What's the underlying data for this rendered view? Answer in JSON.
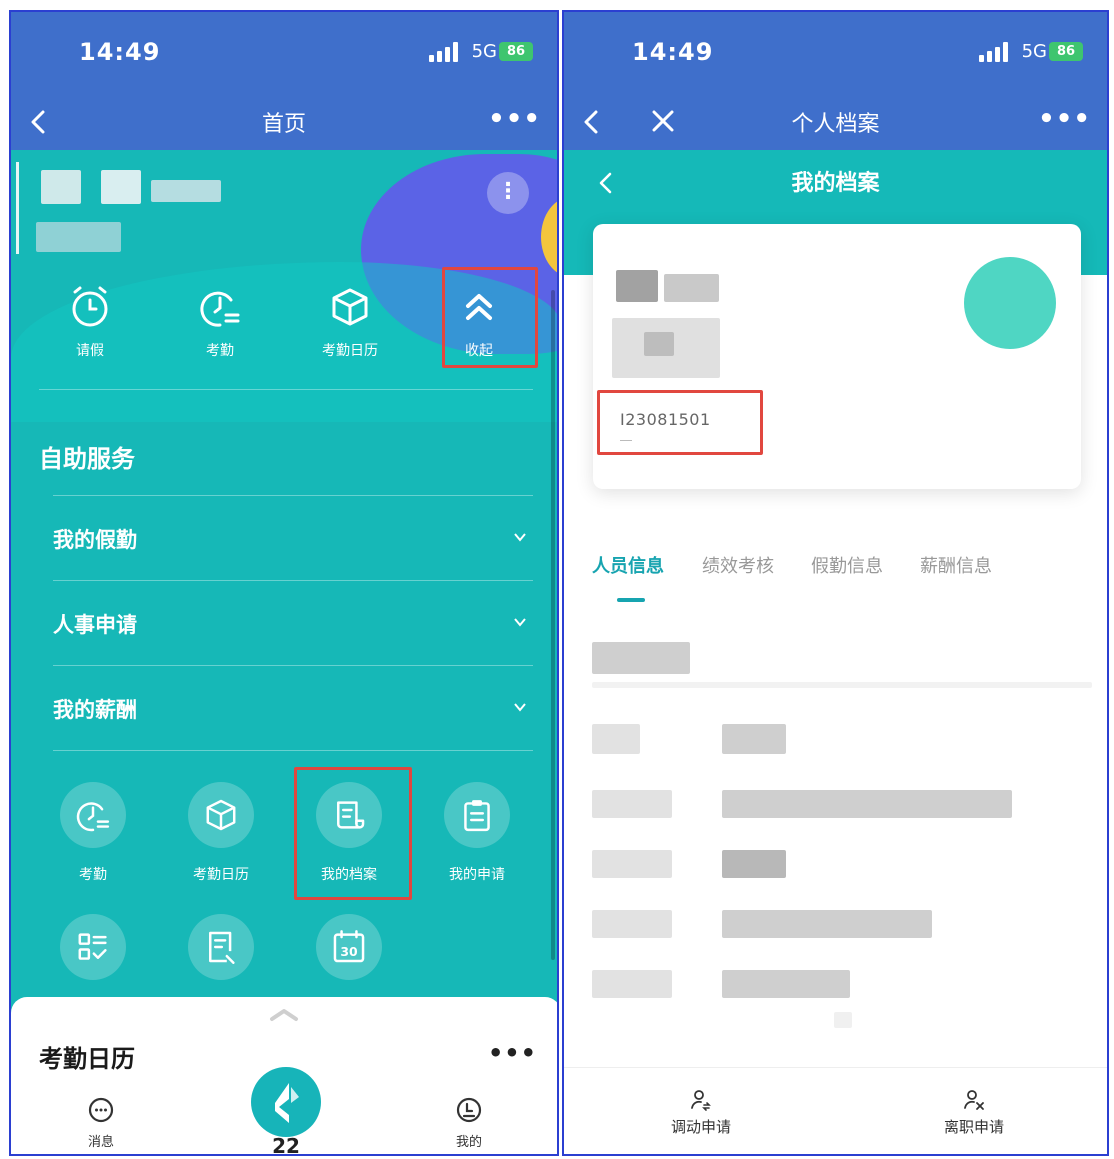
{
  "status_bar": {
    "time": "14:49",
    "network": "5G",
    "battery": "86"
  },
  "left_screen": {
    "nav": {
      "title": "首页",
      "more": "•••"
    },
    "quick_actions": [
      {
        "label": "请假",
        "icon": "alarm-clock-icon"
      },
      {
        "label": "考勤",
        "icon": "attendance-clock-icon"
      },
      {
        "label": "考勤日历",
        "icon": "cube-icon"
      },
      {
        "label": "收起",
        "icon": "double-chevron-up-icon"
      }
    ],
    "section_title": "自助服务",
    "accordion": [
      {
        "label": "我的假勤"
      },
      {
        "label": "人事申请"
      },
      {
        "label": "我的薪酬"
      }
    ],
    "grid": [
      {
        "label": "考勤",
        "icon": "attendance-clock-icon"
      },
      {
        "label": "考勤日历",
        "icon": "cube-icon"
      },
      {
        "label": "我的档案",
        "icon": "scroll-icon"
      },
      {
        "label": "我的申请",
        "icon": "clipboard-icon"
      },
      {
        "label": "",
        "icon": "checklist-icon"
      },
      {
        "label": "",
        "icon": "edit-doc-icon"
      },
      {
        "label": "",
        "icon": "calendar-30-icon"
      }
    ],
    "bottom_sheet": {
      "title": "考勤日历",
      "more": "•••"
    },
    "tabbar": {
      "messages": "消息",
      "center_number": "22",
      "mine": "我的"
    },
    "colors": {
      "primary": "#16b8b7",
      "header": "#3f6fcb",
      "highlight": "#e1473f"
    }
  },
  "right_screen": {
    "nav": {
      "title": "个人档案",
      "more": "•••"
    },
    "subtitle": "我的档案",
    "employee_id": "I23081501",
    "tabs": [
      {
        "label": "人员信息",
        "active": true
      },
      {
        "label": "绩效考核",
        "active": false
      },
      {
        "label": "假勤信息",
        "active": false
      },
      {
        "label": "薪酬信息",
        "active": false
      }
    ],
    "actions": [
      {
        "label": "调动申请",
        "icon": "person-transfer-icon"
      },
      {
        "label": "离职申请",
        "icon": "person-remove-icon"
      }
    ],
    "colors": {
      "accent": "#17a4b0"
    }
  }
}
